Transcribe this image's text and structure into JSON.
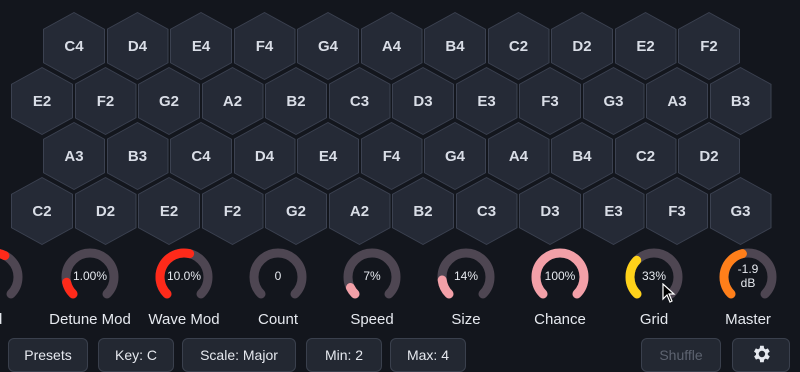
{
  "grid": {
    "rows": [
      [
        "C4",
        "D4",
        "E4",
        "F4",
        "G4",
        "A4",
        "B4",
        "C2",
        "D2",
        "E2",
        "F2"
      ],
      [
        "E2",
        "F2",
        "G2",
        "A2",
        "B2",
        "C3",
        "D3",
        "E3",
        "F3",
        "G3",
        "A3",
        "B3"
      ],
      [
        "A3",
        "B3",
        "C4",
        "D4",
        "E4",
        "F4",
        "G4",
        "A4",
        "B4",
        "C2",
        "D2"
      ],
      [
        "C2",
        "D2",
        "E2",
        "F2",
        "G2",
        "A2",
        "B2",
        "C3",
        "D3",
        "E3",
        "F3",
        "G3"
      ]
    ]
  },
  "knobs": [
    {
      "id": "mod",
      "label": "od",
      "value": "%",
      "fraction": 0.6,
      "color": "#ff2a1a"
    },
    {
      "id": "detune-mod",
      "label": "Detune Mod",
      "value": "1.00%",
      "fraction": 0.12,
      "color": "#ff2a1a"
    },
    {
      "id": "wave-mod",
      "label": "Wave Mod",
      "value": "10.0%",
      "fraction": 0.55,
      "color": "#ff2a1a"
    },
    {
      "id": "count",
      "label": "Count",
      "value": "0",
      "fraction": 0.0,
      "color": "#f3a0a8"
    },
    {
      "id": "speed",
      "label": "Speed",
      "value": "7%",
      "fraction": 0.07,
      "color": "#f3a0a8"
    },
    {
      "id": "size",
      "label": "Size",
      "value": "14%",
      "fraction": 0.14,
      "color": "#f3a0a8"
    },
    {
      "id": "chance",
      "label": "Chance",
      "value": "100%",
      "fraction": 1.0,
      "color": "#f3a0a8"
    },
    {
      "id": "grid",
      "label": "Grid",
      "value": "33%",
      "fraction": 0.33,
      "color": "#ffd21a"
    },
    {
      "id": "master",
      "label": "Master",
      "value": "-1.9\ndB",
      "fraction": 0.45,
      "color": "#ff7f1a"
    }
  ],
  "toolbar": {
    "presets": "Presets",
    "key": "Key: C",
    "scale": "Scale: Major",
    "min": "Min: 2",
    "max": "Max: 4",
    "shuffle": "Shuffle",
    "settings_icon": "gear-icon"
  },
  "colors": {
    "background": "#13161d",
    "hex_fill": "#252a36",
    "hex_border": "#3b4150",
    "knob_track": "#4e4652"
  }
}
